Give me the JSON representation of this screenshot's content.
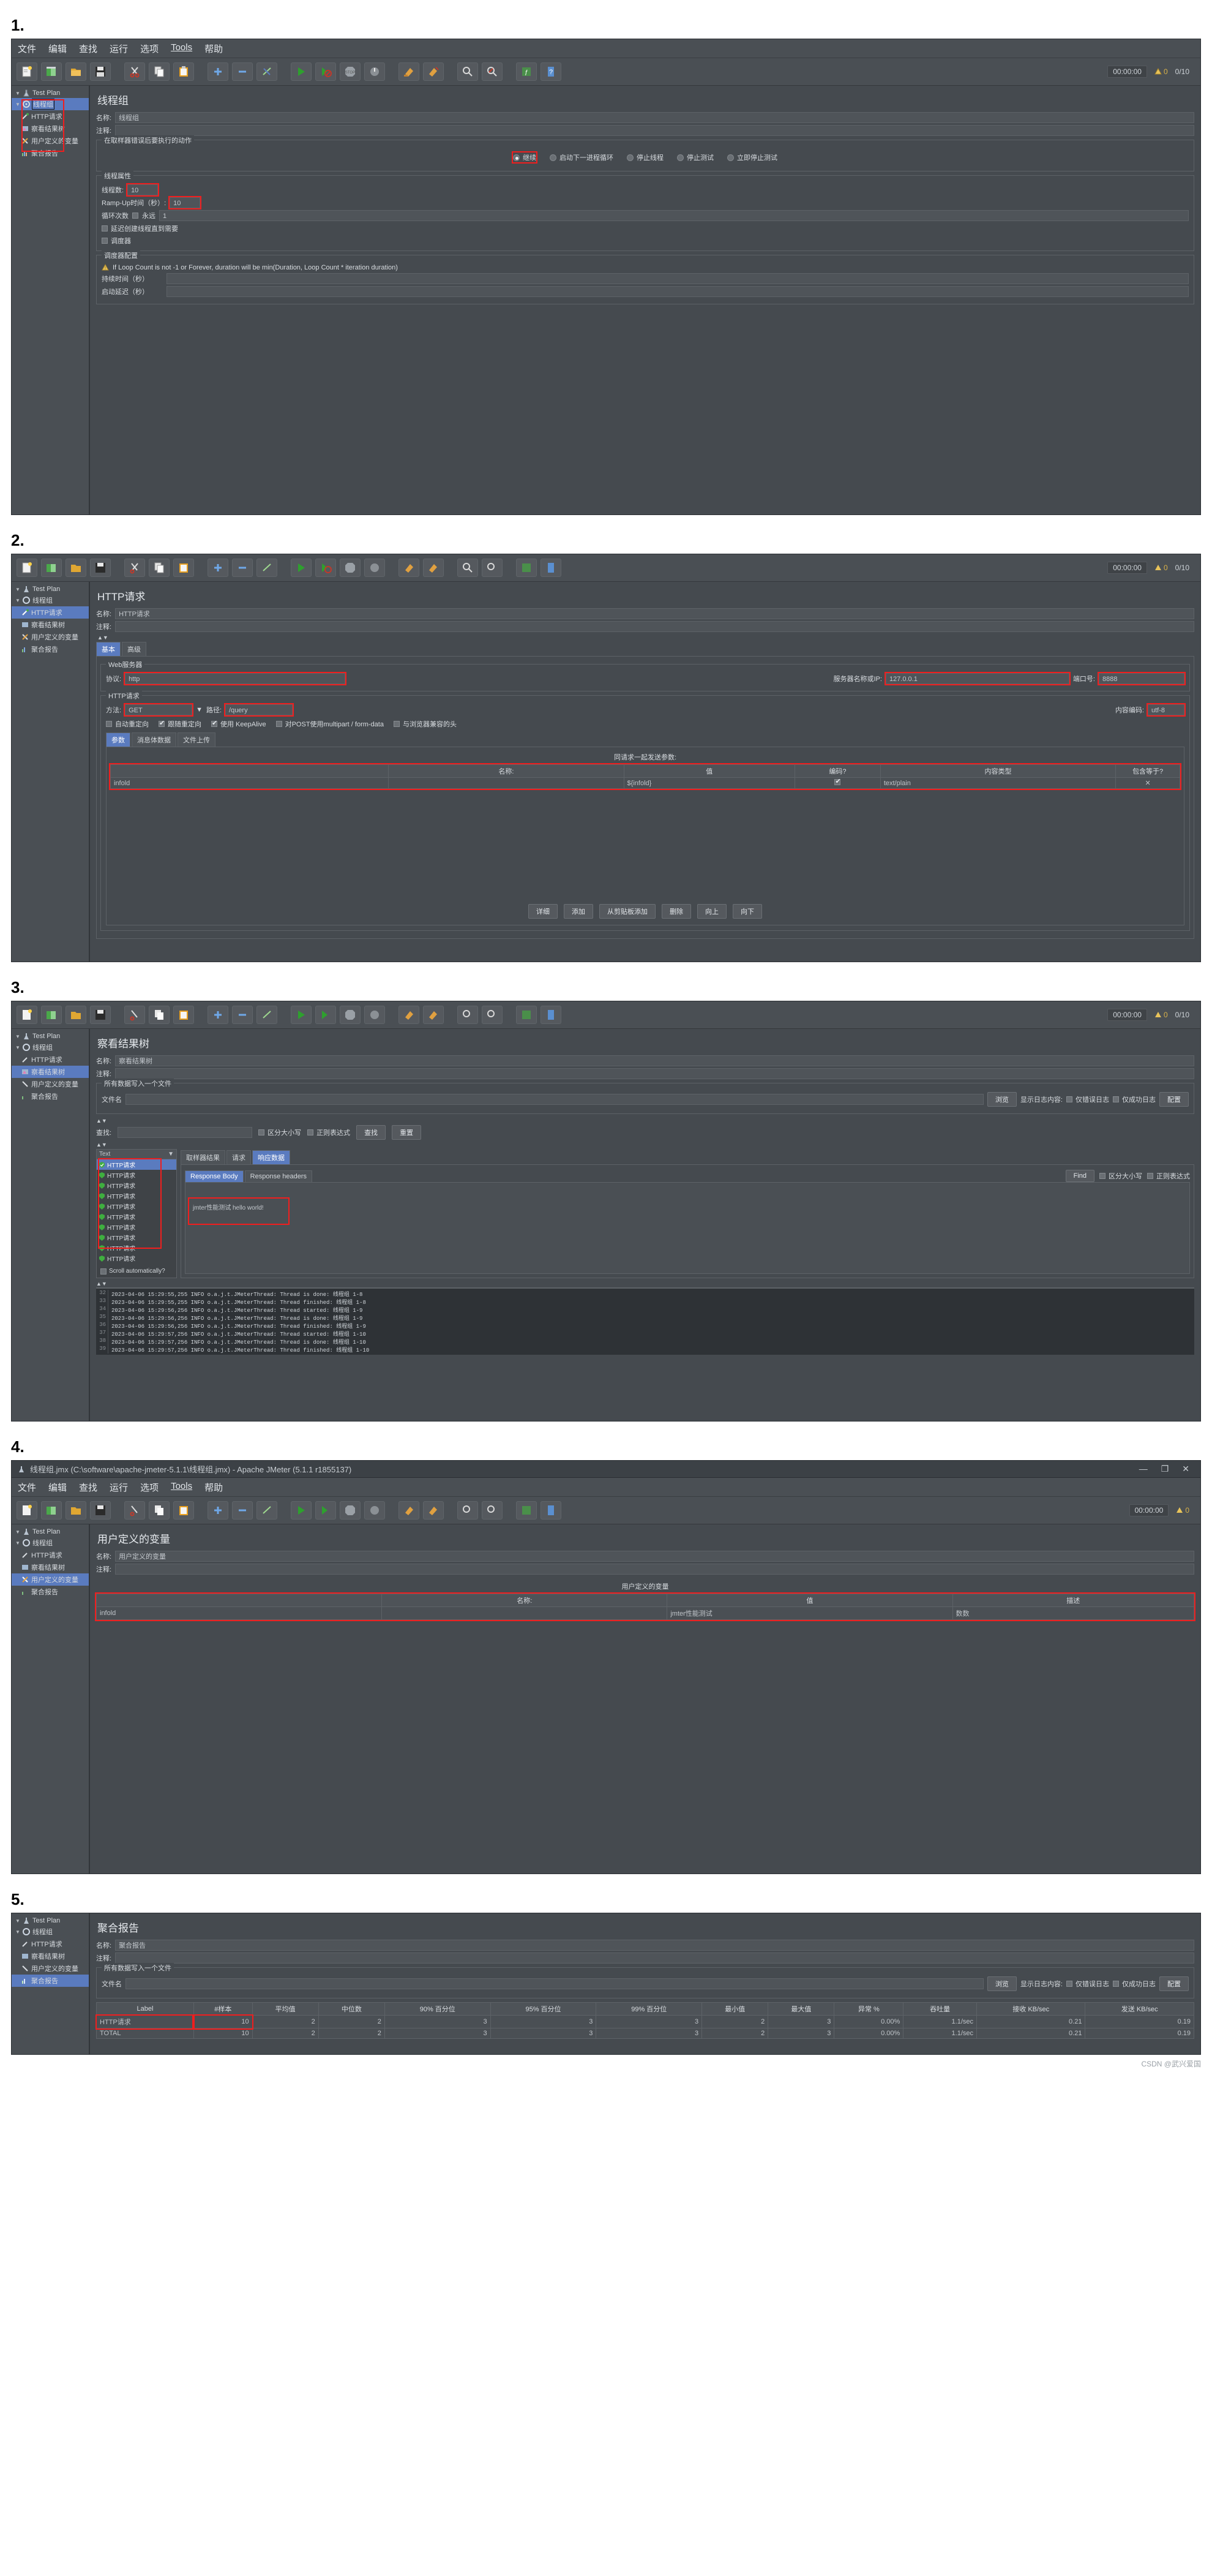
{
  "app": {
    "window_title": "线程组.jmx (C:\\software\\apache-jmeter-5.1.1\\线程组.jmx) - Apache JMeter (5.1.1 r1855137)",
    "menu": [
      "文件",
      "编辑",
      "查找",
      "运行",
      "选项",
      "Tools",
      "帮助"
    ],
    "toolbar_icons": [
      "new-icon",
      "templates-icon",
      "open-icon",
      "save-icon",
      "cut-icon",
      "copy-icon",
      "paste-icon",
      "expand-icon",
      "collapse-icon",
      "toggle-icon",
      "start-icon",
      "start-no-pauses-icon",
      "stop-icon",
      "shutdown-icon",
      "clear-icon",
      "clear-all-icon",
      "search-icon",
      "search-reset-icon",
      "function-helper-icon",
      "help-icon"
    ],
    "clock": "00:00:00",
    "warn_count": "0",
    "thread_count": "0/10"
  },
  "tree": {
    "root": "Test Plan",
    "items": [
      {
        "label": "线程组",
        "icon": "thread-group-icon",
        "level": 1
      },
      {
        "label": "HTTP请求",
        "icon": "http-sampler-icon",
        "level": 2
      },
      {
        "label": "察看结果树",
        "icon": "view-results-tree-icon",
        "level": 2
      },
      {
        "label": "用户定义的变量",
        "icon": "user-defined-variables-icon",
        "level": 2
      },
      {
        "label": "聚合报告",
        "icon": "aggregate-report-icon",
        "level": 2
      }
    ]
  },
  "sections": [
    {
      "num": "1."
    },
    {
      "num": "2."
    },
    {
      "num": "3."
    },
    {
      "num": "4."
    },
    {
      "num": "5."
    }
  ],
  "panel1": {
    "title": "线程组",
    "name_label": "名称:",
    "name_value": "线程组",
    "comment_label": "注释:",
    "comment_value": "",
    "error_action_legend": "在取样器错误后要执行的动作",
    "error_actions": [
      {
        "label": "继续",
        "selected": true
      },
      {
        "label": "启动下一进程循环",
        "selected": false
      },
      {
        "label": "停止线程",
        "selected": false
      },
      {
        "label": "停止测试",
        "selected": false
      },
      {
        "label": "立即停止测试",
        "selected": false
      }
    ],
    "thread_props_legend": "线程属性",
    "threads_label": "线程数:",
    "threads_value": "10",
    "rampup_label": "Ramp-Up时间（秒）:",
    "rampup_value": "10",
    "loops_label": "循环次数",
    "loops_forever_label": "永远",
    "loops_forever_checked": false,
    "loops_value": "1",
    "delay_thread_label": "延迟创建线程直到需要",
    "delay_thread_checked": false,
    "scheduler_label": "调度器",
    "scheduler_checked": false,
    "scheduler_legend": "调度器配置",
    "scheduler_warning": "If Loop Count is not -1 or Forever, duration will be min(Duration, Loop Count * iteration duration)",
    "duration_label": "持续时间（秒）",
    "duration_value": "",
    "startup_delay_label": "启动延迟（秒）",
    "startup_delay_value": ""
  },
  "panel2": {
    "title": "HTTP请求",
    "name_label": "名称:",
    "name_value": "HTTP请求",
    "comment_label": "注释:",
    "comment_value": "",
    "tabs": [
      {
        "label": "基本",
        "active": true
      },
      {
        "label": "高级",
        "active": false
      }
    ],
    "webserver_legend": "Web服务器",
    "protocol_label": "协议:",
    "protocol_value": "http",
    "server_label": "服务器名称或IP:",
    "server_value": "127.0.0.1",
    "port_label": "端口号:",
    "port_value": "8888",
    "httpreq_legend": "HTTP请求",
    "method_label": "方法:",
    "method_value": "GET",
    "path_label": "路径:",
    "path_value": "/query",
    "encoding_label": "内容编码:",
    "encoding_value": "utf-8",
    "checkboxes": [
      {
        "label": "自动重定向",
        "checked": false
      },
      {
        "label": "跟随重定向",
        "checked": true
      },
      {
        "label": "使用 KeepAlive",
        "checked": true
      },
      {
        "label": "对POST使用multipart / form-data",
        "checked": false
      },
      {
        "label": "与浏览器兼容的头",
        "checked": false
      }
    ],
    "subtabs": [
      {
        "label": "参数",
        "active": true
      },
      {
        "label": "消息体数据",
        "active": false
      },
      {
        "label": "文件上传",
        "active": false
      }
    ],
    "params_caption": "同请求一起发送参数:",
    "params_headers": [
      "",
      "名称:",
      "值",
      "编码?",
      "内容类型",
      "包含等于?"
    ],
    "params_rows": [
      {
        "c0": "infold",
        "name": "",
        "value": "${infold}",
        "encode": true,
        "content_type": "text/plain",
        "include_equals": "✕"
      }
    ],
    "buttons": [
      "详细",
      "添加",
      "从剪贴板添加",
      "删除",
      "向上",
      "向下"
    ]
  },
  "panel3": {
    "title": "察看结果树",
    "name_label": "名称:",
    "name_value": "察看结果树",
    "comment_label": "注释:",
    "comment_value": "",
    "file_legend": "所有数据写入一个文件",
    "filename_label": "文件名",
    "filename_value": "",
    "browse_button": "浏览",
    "only_errors_label": "显示日志内容:",
    "only_errors_checkbox": "仅错误日志",
    "only_success_checkbox": "仅成功日志",
    "config_button": "配置",
    "search_label": "查找:",
    "search_value": "",
    "case_sensitive_label": "区分大小写",
    "regex_label": "正则表达式",
    "find_button": "查找",
    "reset_button": "重置",
    "renderer_value": "Text",
    "result_items": [
      "HTTP请求",
      "HTTP请求",
      "HTTP请求",
      "HTTP请求",
      "HTTP请求",
      "HTTP请求",
      "HTTP请求",
      "HTTP请求",
      "HTTP请求",
      "HTTP请求"
    ],
    "scroll_auto_label": "Scroll automatically?",
    "scroll_auto_checked": false,
    "result_tabs": [
      {
        "label": "取样器结果",
        "active": false
      },
      {
        "label": "请求",
        "active": false
      },
      {
        "label": "响应数据",
        "active": true
      }
    ],
    "resp_tabs": [
      {
        "label": "Response Body",
        "active": true
      },
      {
        "label": "Response headers",
        "active": false
      }
    ],
    "find_small": "Find",
    "case_small": "区分大小写",
    "regex_small": "正则表达式",
    "response_text": "jmter性能测试 hello world!",
    "log_lines": [
      {
        "n": "32",
        "text": "2023-04-06 15:29:55,255 INFO o.a.j.t.JMeterThread: Thread is done: 线程组 1-8"
      },
      {
        "n": "33",
        "text": "2023-04-06 15:29:55,255 INFO o.a.j.t.JMeterThread: Thread finished: 线程组 1-8"
      },
      {
        "n": "34",
        "text": "2023-04-06 15:29:56,256 INFO o.a.j.t.JMeterThread: Thread started: 线程组 1-9"
      },
      {
        "n": "35",
        "text": "2023-04-06 15:29:56,256 INFO o.a.j.t.JMeterThread: Thread is done: 线程组 1-9"
      },
      {
        "n": "36",
        "text": "2023-04-06 15:29:56,256 INFO o.a.j.t.JMeterThread: Thread finished: 线程组 1-9"
      },
      {
        "n": "37",
        "text": "2023-04-06 15:29:57,256 INFO o.a.j.t.JMeterThread: Thread started: 线程组 1-10"
      },
      {
        "n": "38",
        "text": "2023-04-06 15:29:57,256 INFO o.a.j.t.JMeterThread: Thread is done: 线程组 1-10"
      },
      {
        "n": "39",
        "text": "2023-04-06 15:29:57,256 INFO o.a.j.t.JMeterThread: Thread finished: 线程组 1-10"
      }
    ]
  },
  "panel4": {
    "title": "用户定义的变量",
    "name_label": "名称:",
    "name_value": "用户定义的变量",
    "comment_label": "注释:",
    "comment_value": "",
    "table_caption": "用户定义的变量",
    "headers": [
      "",
      "名称:",
      "值",
      "描述"
    ],
    "rows": [
      {
        "c0": "infold",
        "name": "",
        "value": "jmter性能测试",
        "desc": "数数"
      }
    ]
  },
  "panel5": {
    "title": "聚合报告",
    "name_label": "名称:",
    "name_value": "聚合报告",
    "comment_label": "注释:",
    "comment_value": "",
    "file_legend": "所有数据写入一个文件",
    "filename_label": "文件名",
    "filename_value": "",
    "browse_button": "浏览",
    "only_errors_label": "显示日志内容:",
    "only_errors_checkbox": "仅错误日志",
    "only_success_checkbox": "仅成功日志",
    "config_button": "配置",
    "headers": [
      "Label",
      "#样本",
      "平均值",
      "中位数",
      "90% 百分位",
      "95% 百分位",
      "99% 百分位",
      "最小值",
      "最大值",
      "异常 %",
      "吞吐量",
      "接收 KB/sec",
      "发送 KB/sec"
    ],
    "rows": [
      {
        "label": "HTTP请求",
        "samples": "10",
        "average": "2",
        "median": "2",
        "p90": "3",
        "p95": "3",
        "p99": "3",
        "min": "2",
        "max": "3",
        "error": "0.00%",
        "throughput": "1.1/sec",
        "received": "0.21",
        "sent": "0.19"
      },
      {
        "label": "TOTAL",
        "samples": "10",
        "average": "2",
        "median": "2",
        "p90": "3",
        "p95": "3",
        "p99": "3",
        "min": "2",
        "max": "3",
        "error": "0.00%",
        "throughput": "1.1/sec",
        "received": "0.21",
        "sent": "0.19"
      }
    ]
  },
  "watermark": "CSDN @武兴爱国"
}
